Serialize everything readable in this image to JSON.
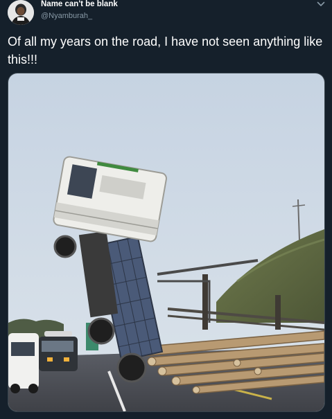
{
  "tweet": {
    "author_name": "Name can't be blank",
    "author_handle": "@Nyamburah_",
    "text": "Of all my years on the road, I have not seen anything like this!!!",
    "menu_icon": "chevron-down-icon",
    "photo_icon": "photo"
  },
  "colors": {
    "background": "#15202b",
    "secondary_text": "#8899a6",
    "border": "#38444d"
  }
}
